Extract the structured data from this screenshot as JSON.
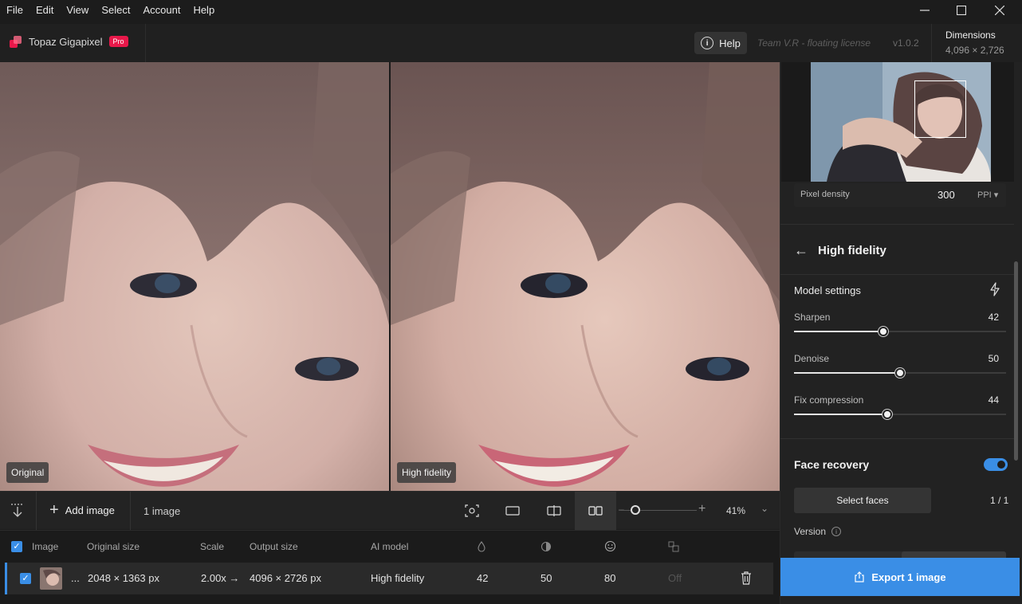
{
  "menu": [
    "File",
    "Edit",
    "View",
    "Select",
    "Account",
    "Help"
  ],
  "window_controls": {
    "minimize": "—",
    "maximize": "☐",
    "close": "✕"
  },
  "app": {
    "name": "Topaz Gigapixel",
    "badge": "Pro",
    "help_label": "Help",
    "license": "Team V.R - floating license",
    "version": "v1.0.2",
    "dimensions_title": "Dimensions",
    "dimensions_value": "4,096 × 2,726"
  },
  "panes": {
    "left_label": "Original",
    "right_label": "High fidelity"
  },
  "toolbar": {
    "add_image": "Add image",
    "image_count": "1 image",
    "zoom_percent": "41%",
    "zoom_level": 0.2,
    "views": [
      "camera-icon",
      "single-view-icon",
      "split-view-icon",
      "side-by-side-view-icon"
    ],
    "active_view": 3
  },
  "table": {
    "headers": {
      "image": "Image",
      "original_size": "Original size",
      "scale": "Scale",
      "output_size": "Output size",
      "ai_model": "AI model"
    },
    "header_icons": [
      "sharpen-icon",
      "denoise-icon",
      "face-icon",
      "compression-icon"
    ],
    "row": {
      "ellipsis": "...",
      "original_size": "2048 × 1363 px",
      "scale": "2.00x →",
      "output_size": "4096 × 2726 px",
      "ai_model": "High fidelity",
      "sharpen": "42",
      "denoise": "50",
      "face": "80",
      "compression": "Off"
    }
  },
  "sidebar": {
    "pixel_density_label": "Pixel density",
    "pixel_density_value": "300",
    "pixel_density_unit": "PPI",
    "model_title": "High fidelity",
    "model_settings": "Model settings",
    "sliders": [
      {
        "label": "Sharpen",
        "value": "42",
        "level": 0.42
      },
      {
        "label": "Denoise",
        "value": "50",
        "level": 0.5
      },
      {
        "label": "Fix compression",
        "value": "44",
        "level": 0.44
      }
    ],
    "face_recovery": "Face recovery",
    "face_recovery_on": true,
    "select_faces": "Select faces",
    "face_count": "1 / 1",
    "version_label": "Version",
    "export": "Export 1 image"
  },
  "colors": {
    "accent": "#3a8ee6",
    "brand": "#e8184a"
  }
}
